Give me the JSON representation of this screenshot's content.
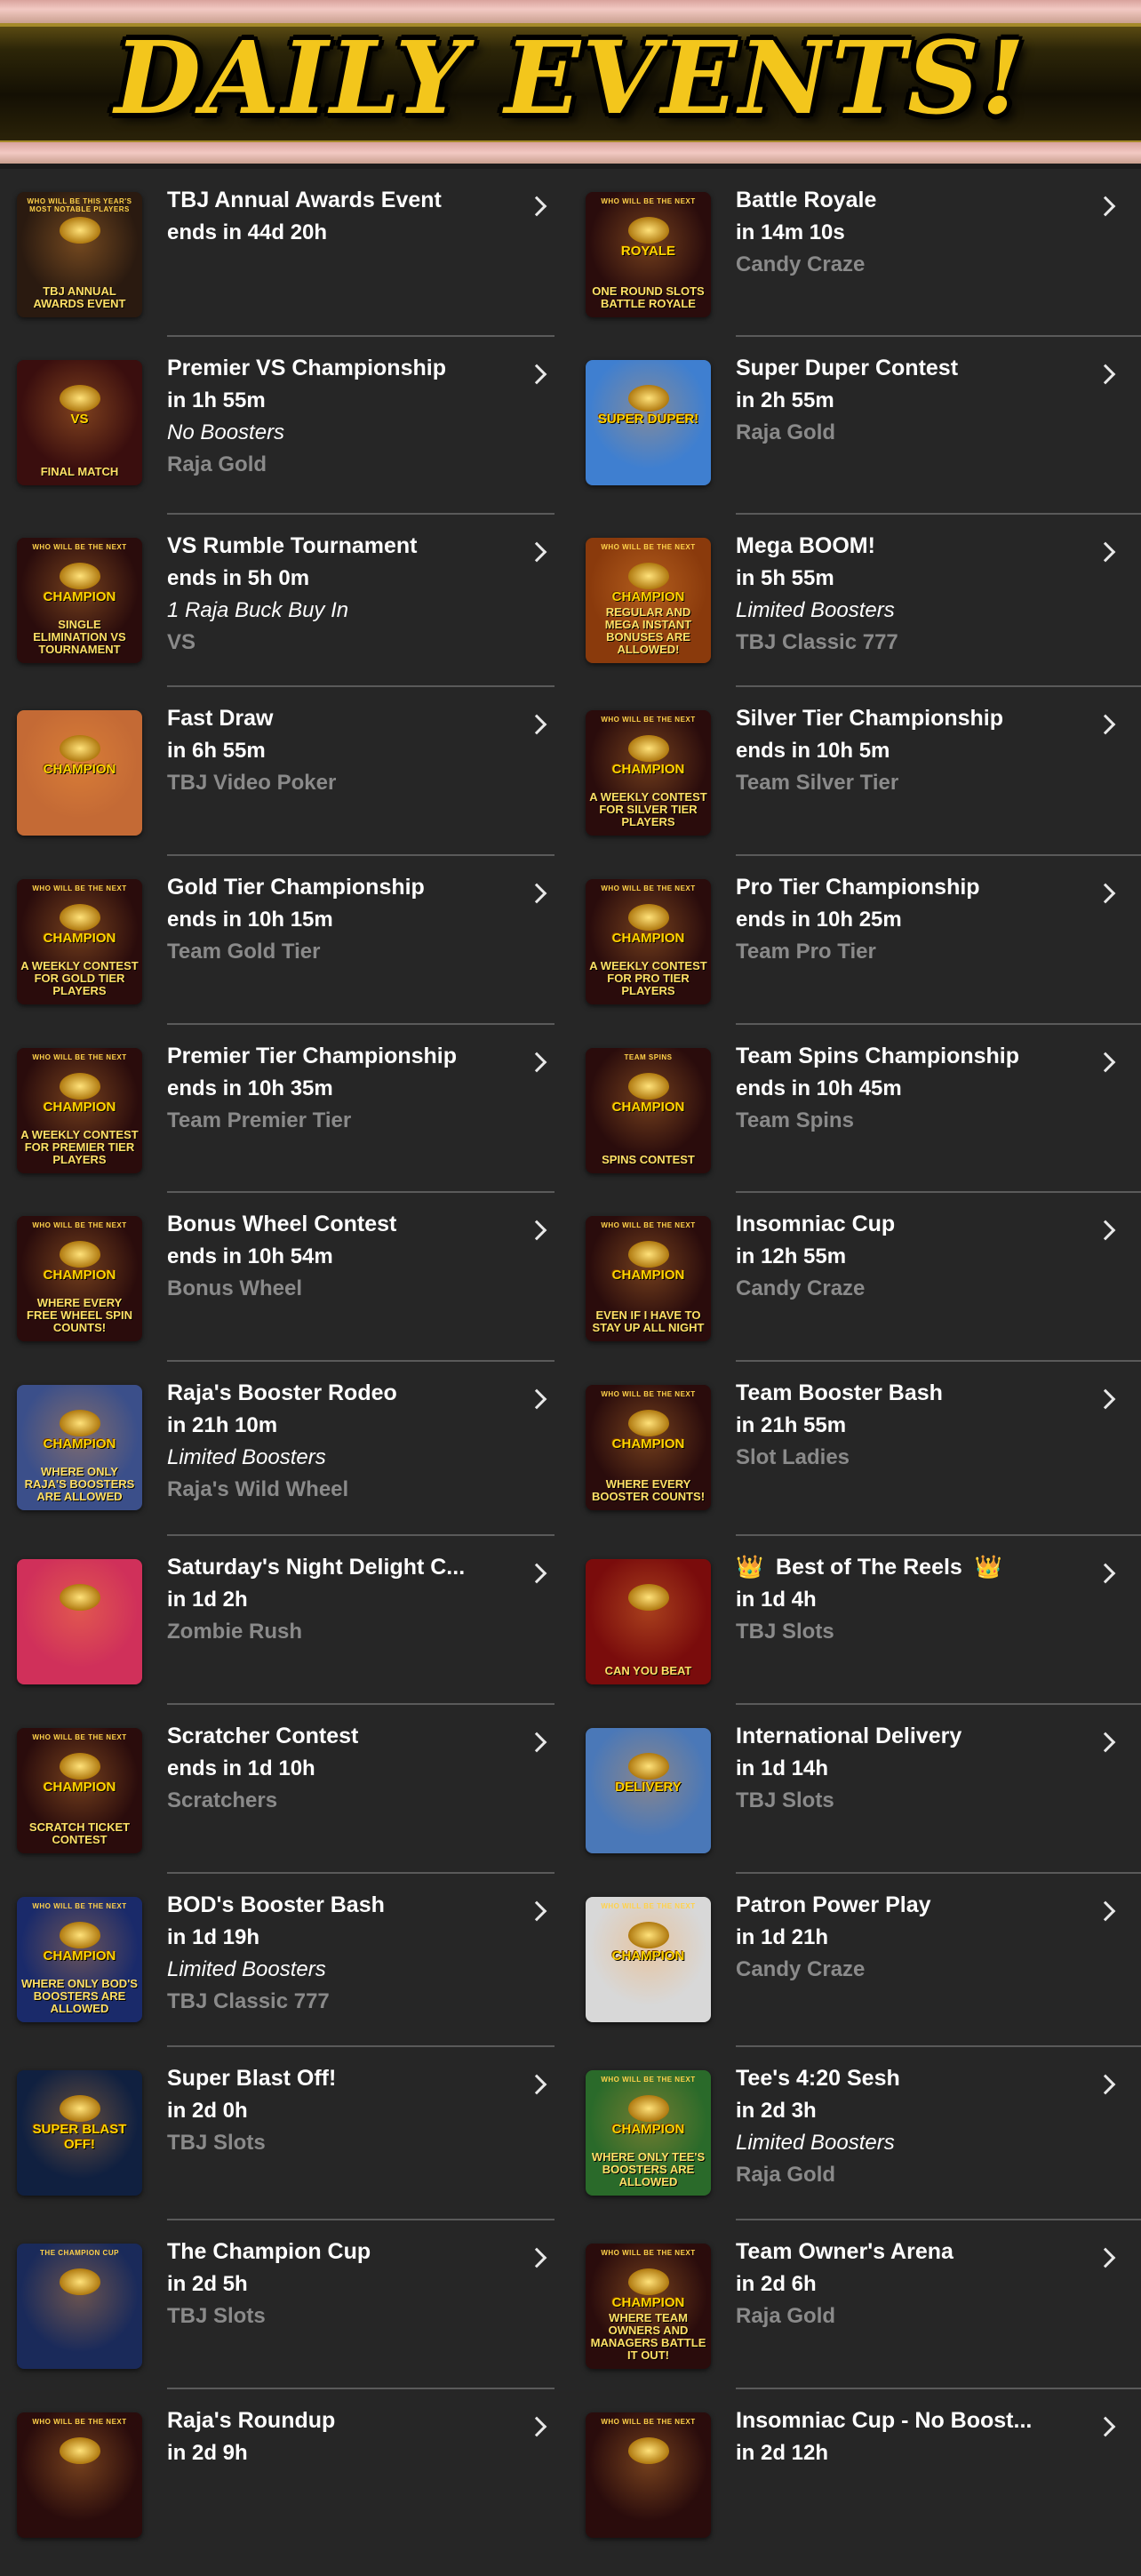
{
  "header": {
    "title": "DAILY EVENTS!"
  },
  "colors": {
    "background": "#262626",
    "title_gold": "#f3c61c",
    "subtitle_gray": "#8a8a8a",
    "divider": "#5a5a5a"
  },
  "events": [
    {
      "title": "TBJ Annual Awards Event",
      "time": "ends in 44d 20h",
      "italic": "",
      "sub": "",
      "thumb_top": "WHO WILL BE THIS YEAR'S MOST NOTABLE PLAYERS",
      "thumb_caption": "TBJ ANNUAL AWARDS EVENT",
      "thumb_mid": "",
      "thumb_bg": "#2a1a10"
    },
    {
      "title": "Battle Royale",
      "time": "in 14m 10s",
      "italic": "",
      "sub": "Candy Craze",
      "thumb_top": "WHO WILL BE THE NEXT",
      "thumb_caption": "ONE ROUND SLOTS BATTLE ROYALE",
      "thumb_mid": "ROYALE",
      "thumb_bg": "#2a0c0c"
    },
    {
      "title": "Premier VS Championship",
      "time": "in 1h 55m",
      "italic": "No Boosters",
      "sub": "Raja Gold",
      "thumb_top": "",
      "thumb_caption": "FINAL MATCH",
      "thumb_mid": "VS",
      "thumb_bg": "#3a0e0e"
    },
    {
      "title": "Super Duper Contest",
      "time": "in 2h 55m",
      "italic": "",
      "sub": "Raja Gold",
      "thumb_top": "",
      "thumb_caption": "",
      "thumb_mid": "SUPER DUPER!",
      "thumb_bg": "#3f7fd0"
    },
    {
      "title": "VS Rumble Tournament",
      "time": "ends in 5h 0m",
      "italic": "1 Raja Buck Buy In",
      "sub": "VS",
      "thumb_top": "WHO WILL BE THE NEXT",
      "thumb_caption": "SINGLE ELIMINATION VS TOURNAMENT",
      "thumb_mid": "CHAMPION",
      "thumb_bg": "#2a0c0c"
    },
    {
      "title": "Mega BOOM!",
      "time": "in 5h 55m",
      "italic": "Limited Boosters",
      "sub": "TBJ Classic 777",
      "thumb_top": "WHO WILL BE THE NEXT",
      "thumb_caption": "REGULAR AND MEGA INSTANT BONUSES ARE ALLOWED!",
      "thumb_mid": "CHAMPION",
      "thumb_bg": "#8a3a0c"
    },
    {
      "title": "Fast Draw",
      "time": "in 6h 55m",
      "italic": "",
      "sub": "TBJ Video Poker",
      "thumb_top": "",
      "thumb_caption": "",
      "thumb_mid": "CHAMPION",
      "thumb_bg": "#c46a35"
    },
    {
      "title": "Silver Tier Championship",
      "time": "ends in 10h 5m",
      "italic": "",
      "sub": "Team Silver Tier",
      "thumb_top": "WHO WILL BE THE NEXT",
      "thumb_caption": "A WEEKLY CONTEST FOR SILVER TIER PLAYERS",
      "thumb_mid": "CHAMPION",
      "thumb_bg": "#2a0c0c"
    },
    {
      "title": "Gold Tier Championship",
      "time": "ends in 10h 15m",
      "italic": "",
      "sub": "Team Gold Tier",
      "thumb_top": "WHO WILL BE THE NEXT",
      "thumb_caption": "A WEEKLY CONTEST FOR GOLD TIER PLAYERS",
      "thumb_mid": "CHAMPION",
      "thumb_bg": "#2a0c0c"
    },
    {
      "title": "Pro Tier Championship",
      "time": "ends in 10h 25m",
      "italic": "",
      "sub": "Team Pro Tier",
      "thumb_top": "WHO WILL BE THE NEXT",
      "thumb_caption": "A WEEKLY CONTEST FOR PRO TIER PLAYERS",
      "thumb_mid": "CHAMPION",
      "thumb_bg": "#2a0c0c"
    },
    {
      "title": "Premier Tier Championship",
      "time": "ends in 10h 35m",
      "italic": "",
      "sub": "Team Premier Tier",
      "thumb_top": "WHO WILL BE THE NEXT",
      "thumb_caption": "A WEEKLY CONTEST FOR PREMIER TIER PLAYERS",
      "thumb_mid": "CHAMPION",
      "thumb_bg": "#2a0c0c"
    },
    {
      "title": "Team Spins Championship",
      "time": "ends in 10h 45m",
      "italic": "",
      "sub": "Team Spins",
      "thumb_top": "TEAM SPINS",
      "thumb_caption": "SPINS CONTEST",
      "thumb_mid": "CHAMPION",
      "thumb_bg": "#2a0c0c"
    },
    {
      "title": "Bonus Wheel Contest",
      "time": "ends in 10h 54m",
      "italic": "",
      "sub": "Bonus Wheel",
      "thumb_top": "WHO WILL BE THE NEXT",
      "thumb_caption": "WHERE EVERY FREE WHEEL SPIN COUNTS!",
      "thumb_mid": "CHAMPION",
      "thumb_bg": "#2a0c0c"
    },
    {
      "title": "Insomniac Cup",
      "time": "in 12h 55m",
      "italic": "",
      "sub": "Candy Craze",
      "thumb_top": "WHO WILL BE THE NEXT",
      "thumb_caption": "EVEN IF I HAVE TO STAY UP ALL NIGHT",
      "thumb_mid": "CHAMPION",
      "thumb_bg": "#2a0c0c"
    },
    {
      "title": "Raja's Booster Rodeo",
      "time": "in 21h 10m",
      "italic": "Limited Boosters",
      "sub": "Raja's Wild Wheel",
      "thumb_top": "",
      "thumb_caption": "WHERE ONLY RAJA'S BOOSTERS ARE ALLOWED",
      "thumb_mid": "CHAMPION",
      "thumb_bg": "#3b4f8a"
    },
    {
      "title": "Team Booster Bash",
      "time": "in 21h 55m",
      "italic": "",
      "sub": "Slot Ladies",
      "thumb_top": "WHO WILL BE THE NEXT",
      "thumb_caption": "WHERE EVERY BOOSTER COUNTS!",
      "thumb_mid": "CHAMPION",
      "thumb_bg": "#2a0c0c"
    },
    {
      "title": "Saturday's Night Delight C...",
      "time": "in 1d 2h",
      "italic": "",
      "sub": "Zombie Rush",
      "thumb_top": "",
      "thumb_caption": "",
      "thumb_mid": "",
      "thumb_bg": "#d0305a"
    },
    {
      "title": "Best of The Reels",
      "time": "in 1d 4h",
      "italic": "",
      "sub": "TBJ Slots",
      "thumb_top": "",
      "thumb_caption": "CAN YOU BEAT",
      "thumb_mid": "",
      "thumb_bg": "#7a0c0c",
      "crown": "👑"
    },
    {
      "title": "Scratcher Contest",
      "time": "ends in 1d 10h",
      "italic": "",
      "sub": "Scratchers",
      "thumb_top": "WHO WILL BE THE NEXT",
      "thumb_caption": "SCRATCH TICKET CONTEST",
      "thumb_mid": "CHAMPION",
      "thumb_bg": "#2a0c0c"
    },
    {
      "title": "International Delivery",
      "time": "in 1d 14h",
      "italic": "",
      "sub": "TBJ Slots",
      "thumb_top": "",
      "thumb_caption": "",
      "thumb_mid": "DELIVERY",
      "thumb_bg": "#4a78b8"
    },
    {
      "title": "BOD's Booster Bash",
      "time": "in 1d 19h",
      "italic": "Limited Boosters",
      "sub": "TBJ Classic 777",
      "thumb_top": "WHO WILL BE THE NEXT",
      "thumb_caption": "WHERE ONLY BOD'S BOOSTERS ARE ALLOWED",
      "thumb_mid": "CHAMPION",
      "thumb_bg": "#1a2a6a"
    },
    {
      "title": "Patron Power Play",
      "time": "in 1d 21h",
      "italic": "",
      "sub": "Candy Craze",
      "thumb_top": "WHO WILL BE THE NEXT",
      "thumb_caption": "",
      "thumb_mid": "CHAMPION",
      "thumb_bg": "#d8d8d8"
    },
    {
      "title": "Super Blast Off!",
      "time": "in 2d 0h",
      "italic": "",
      "sub": "TBJ Slots",
      "thumb_top": "",
      "thumb_caption": "",
      "thumb_mid": "SUPER BLAST OFF!",
      "thumb_bg": "#102040"
    },
    {
      "title": "Tee's 4:20 Sesh",
      "time": "in 2d 3h",
      "italic": "Limited Boosters",
      "sub": "Raja Gold",
      "thumb_top": "WHO WILL BE THE NEXT",
      "thumb_caption": "WHERE ONLY TEE'S BOOSTERS ARE ALLOWED",
      "thumb_mid": "CHAMPION",
      "thumb_bg": "#2a6a2a"
    },
    {
      "title": "The Champion Cup",
      "time": "in 2d 5h",
      "italic": "",
      "sub": "TBJ Slots",
      "thumb_top": "THE CHAMPION CUP",
      "thumb_caption": "",
      "thumb_mid": "",
      "thumb_bg": "#1a2a5a"
    },
    {
      "title": "Team Owner's Arena",
      "time": "in 2d 6h",
      "italic": "",
      "sub": "Raja Gold",
      "thumb_top": "WHO WILL BE THE NEXT",
      "thumb_caption": "WHERE TEAM OWNERS AND MANAGERS BATTLE IT OUT!",
      "thumb_mid": "CHAMPION",
      "thumb_bg": "#2a0c0c"
    },
    {
      "title": "Raja's Roundup",
      "time": "in 2d 9h",
      "italic": "",
      "sub": "",
      "thumb_top": "WHO WILL BE THE NEXT",
      "thumb_caption": "",
      "thumb_mid": "",
      "thumb_bg": "#2a0c0c"
    },
    {
      "title": "Insomniac Cup - No Boost...",
      "time": "in 2d 12h",
      "italic": "",
      "sub": "",
      "thumb_top": "WHO WILL BE THE NEXT",
      "thumb_caption": "",
      "thumb_mid": "",
      "thumb_bg": "#2a0c0c"
    }
  ]
}
